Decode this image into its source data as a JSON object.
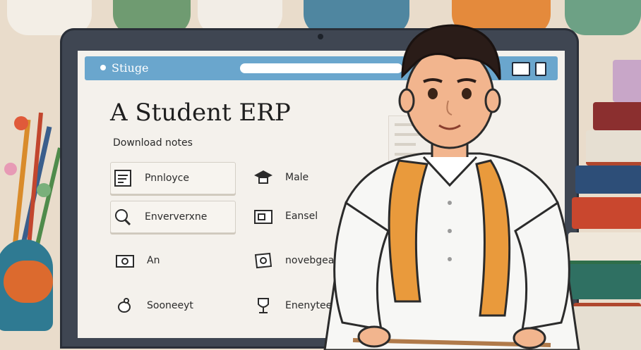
{
  "browser": {
    "brand": "Stiuge"
  },
  "screen": {
    "title": "A Student ERP",
    "subtitle": "Download notes",
    "menu_left": [
      {
        "label": "Pnnloyce",
        "icon": "document-icon"
      },
      {
        "label": "Enververxne",
        "icon": "magnifier-icon"
      },
      {
        "label": "An",
        "icon": "camera-icon"
      },
      {
        "label": "Sooneeyt",
        "icon": "bird-icon"
      }
    ],
    "menu_right": [
      {
        "label": "Male",
        "icon": "graduation-cap-icon"
      },
      {
        "label": "Eansel",
        "icon": "folder-icon"
      },
      {
        "label": "novebgeaun",
        "icon": "scroll-icon"
      },
      {
        "label": "Enenytee",
        "icon": "trophy-icon"
      }
    ]
  },
  "colors": {
    "url_bar": "#6aa6cd",
    "screen_bg": "#f4f1ec",
    "bezel": "#3f4652",
    "shirt": "#f7f7f5",
    "scarf": "#e99a3c",
    "background": "#e9dccb"
  }
}
